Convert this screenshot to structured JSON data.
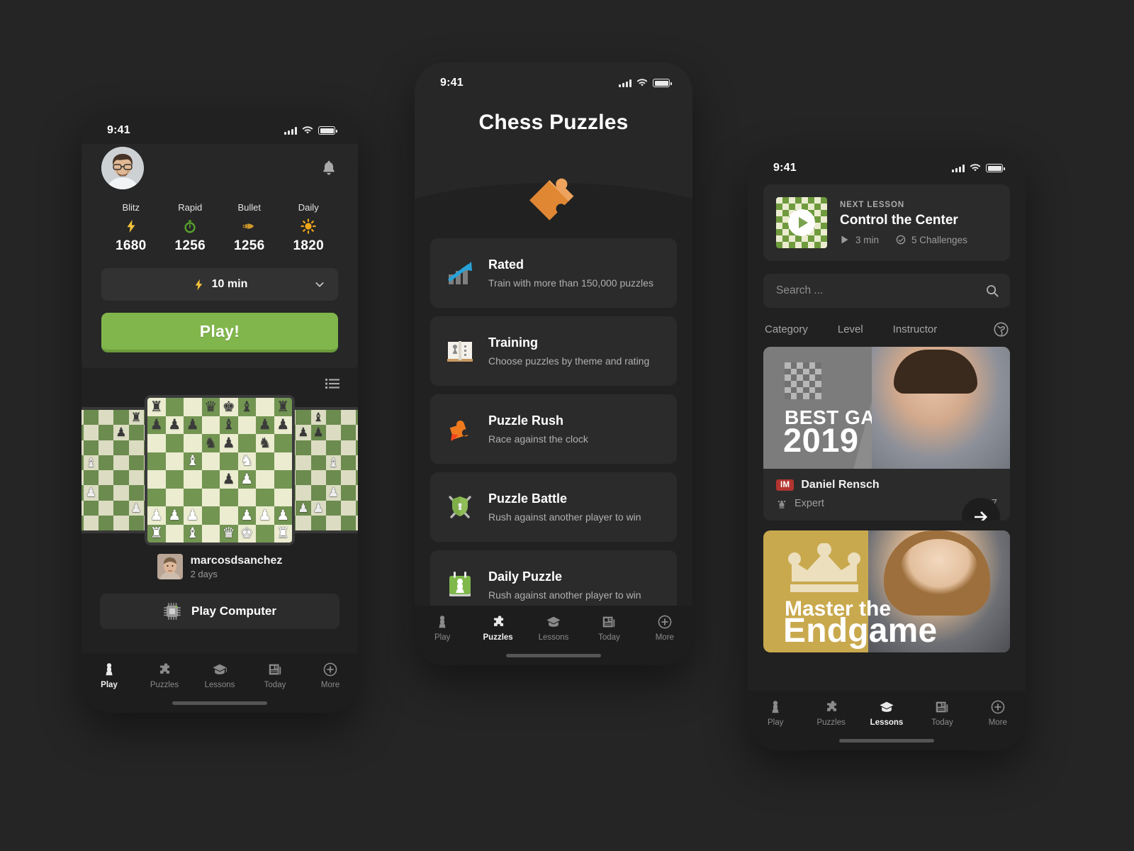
{
  "statusbar": {
    "time": "9:41"
  },
  "phone_play": {
    "stats": [
      {
        "label": "Blitz",
        "icon": "lightning-bolt",
        "value": "1680"
      },
      {
        "label": "Rapid",
        "icon": "stopwatch",
        "value": "1256"
      },
      {
        "label": "Bullet",
        "icon": "bullet",
        "value": "1256"
      },
      {
        "label": "Daily",
        "icon": "sun",
        "value": "1820"
      }
    ],
    "time_control": "10 min",
    "play_button": "Play!",
    "opponent": {
      "name": "marcosdsanchez",
      "subtitle": "2 days"
    },
    "play_computer": "Play Computer",
    "accent_green": "#81b64c",
    "tabs": [
      {
        "label": "Play",
        "active": true
      },
      {
        "label": "Puzzles",
        "active": false
      },
      {
        "label": "Lessons",
        "active": false
      },
      {
        "label": "Today",
        "active": false
      },
      {
        "label": "More",
        "active": false
      }
    ]
  },
  "phone_puzzles": {
    "title": "Chess Puzzles",
    "items": [
      {
        "title": "Rated",
        "subtitle": "Train with more than 150,000 puzzles",
        "icon": "chart-up-icon"
      },
      {
        "title": "Training",
        "subtitle": "Choose puzzles by theme and rating",
        "icon": "open-book-icon"
      },
      {
        "title": "Puzzle Rush",
        "subtitle": "Race against the clock",
        "icon": "orange-puzzle-icon"
      },
      {
        "title": "Puzzle Battle",
        "subtitle": "Rush against another player to win",
        "icon": "shield-swords-icon"
      },
      {
        "title": "Daily Puzzle",
        "subtitle": "Rush against another player to win",
        "icon": "calendar-pawn-icon"
      }
    ],
    "tabs": [
      {
        "label": "Play",
        "active": false
      },
      {
        "label": "Puzzles",
        "active": true
      },
      {
        "label": "Lessons",
        "active": false
      },
      {
        "label": "Today",
        "active": false
      },
      {
        "label": "More",
        "active": false
      }
    ]
  },
  "phone_lessons": {
    "next_lesson": {
      "kicker": "NEXT LESSON",
      "title": "Control the Center",
      "duration": "3 min",
      "challenges": "5 Challenges"
    },
    "search_placeholder": "Search ...",
    "filters": [
      "Category",
      "Level",
      "Instructor"
    ],
    "course_card": {
      "banner_line1": "BEST GAMES",
      "banner_line2": "2019",
      "badge": "IM",
      "instructor": "Daniel Rensch",
      "level": "Expert",
      "lesson_count": "7"
    },
    "promo_card": {
      "line1": "Master the",
      "line2": "Endgame",
      "color": "#c9a94e"
    },
    "tabs": [
      {
        "label": "Play",
        "active": false
      },
      {
        "label": "Puzzles",
        "active": false
      },
      {
        "label": "Lessons",
        "active": true
      },
      {
        "label": "Today",
        "active": false
      },
      {
        "label": "More",
        "active": false
      }
    ]
  }
}
